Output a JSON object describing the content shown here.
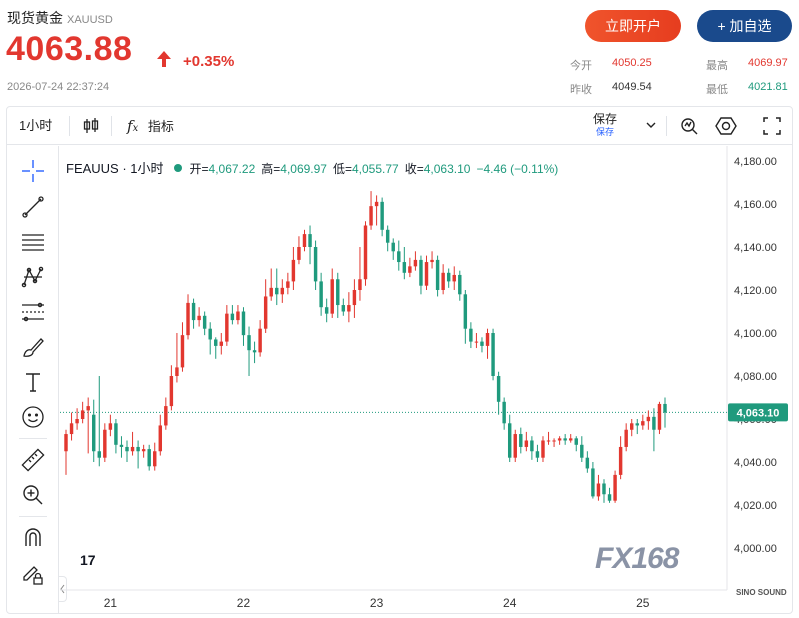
{
  "header": {
    "title": "现货黄金",
    "symbol": "XAUUSD",
    "price": "4063.88",
    "change": "+0.35%",
    "timestamp": "2026-07-24 22:37:24",
    "btn_open": "立即开户",
    "btn_add": "+ 加自选",
    "open_label": "今开",
    "open_value": "4050.25",
    "prev_label": "昨收",
    "prev_value": "4049.54",
    "high_label": "最高",
    "high_value": "4069.97",
    "low_label": "最低",
    "low_value": "4021.81"
  },
  "toolbar": {
    "interval": "1小时",
    "indicators": "指标",
    "save": "保存",
    "save_sub": "保存"
  },
  "sidebar": {
    "tools": [
      "crosshair-icon",
      "trend-line-icon",
      "horizontal-lines-icon",
      "pattern-icon",
      "fib-icon",
      "brush-icon",
      "text-icon",
      "emoji-icon",
      "ruler-icon",
      "zoom-in-icon",
      "magnet-icon",
      "lock-pencil-icon"
    ]
  },
  "legend": {
    "symbol": "FEAUUS · 1小时",
    "open_k": "开=",
    "open_v": "4,067.22",
    "high_k": "高=",
    "high_v": "4,069.97",
    "low_k": "低=",
    "low_v": "4,055.77",
    "close_k": "收=",
    "close_v": "4,063.10",
    "change_v": "−4.46 (−0.11%)"
  },
  "branding": {
    "tv": "17",
    "fx": "FX168",
    "sino": "SINO SOUND"
  },
  "colors": {
    "up": "#e2372f",
    "down": "#1f9a7d",
    "accent": "#2962ff",
    "brand_blue": "#1a4a8c"
  },
  "chart_data": {
    "type": "candlestick",
    "ylim": [
      3985,
      4185
    ],
    "y_ticks": [
      "4,000.00",
      "4,020.00",
      "4,040.00",
      "4,060.00",
      "4,080.00",
      "4,100.00",
      "4,120.00",
      "4,140.00",
      "4,160.00",
      "4,180.00"
    ],
    "y_tick_values": [
      4000,
      4020,
      4040,
      4060,
      4080,
      4100,
      4120,
      4140,
      4160,
      4180
    ],
    "x_labels": [
      "21",
      "22",
      "23",
      "24",
      "25"
    ],
    "x_label_index": [
      8,
      32,
      56,
      80,
      104
    ],
    "last_price_label": "4,063.10",
    "last_price": 4063.1,
    "candles": [
      [
        4045,
        4053,
        4034,
        4055
      ],
      [
        4053,
        4058,
        4050,
        4063
      ],
      [
        4058,
        4060,
        4055,
        4065
      ],
      [
        4060,
        4064,
        4058,
        4068
      ],
      [
        4064,
        4066,
        4044,
        4070
      ],
      [
        4062,
        4045,
        4040,
        4069
      ],
      [
        4045,
        4042,
        4038,
        4080
      ],
      [
        4042,
        4055,
        4040,
        4058
      ],
      [
        4055,
        4058,
        4052,
        4062
      ],
      [
        4058,
        4048,
        4044,
        4060
      ],
      [
        4048,
        4047,
        4042,
        4052
      ],
      [
        4047,
        4045,
        4040,
        4050
      ],
      [
        4045,
        4047,
        4043,
        4054
      ],
      [
        4047,
        4045,
        4037,
        4050
      ],
      [
        4045,
        4046,
        4042,
        4048
      ],
      [
        4046,
        4038,
        4036,
        4048
      ],
      [
        4038,
        4045,
        4036,
        4049
      ],
      [
        4045,
        4057,
        4043,
        4062
      ],
      [
        4057,
        4066,
        4055,
        4070
      ],
      [
        4066,
        4080,
        4064,
        4085
      ],
      [
        4080,
        4084,
        4077,
        4100
      ],
      [
        4084,
        4099,
        4082,
        4105
      ],
      [
        4099,
        4114,
        4097,
        4118
      ],
      [
        4114,
        4106,
        4102,
        4116
      ],
      [
        4106,
        4108,
        4103,
        4112
      ],
      [
        4108,
        4102,
        4099,
        4110
      ],
      [
        4102,
        4097,
        4090,
        4105
      ],
      [
        4097,
        4094,
        4088,
        4098
      ],
      [
        4094,
        4096,
        4090,
        4100
      ],
      [
        4096,
        4109,
        4094,
        4113
      ],
      [
        4109,
        4106,
        4104,
        4113
      ],
      [
        4106,
        4110,
        4104,
        4113
      ],
      [
        4110,
        4099,
        4094,
        4112
      ],
      [
        4099,
        4092,
        4080,
        4103
      ],
      [
        4092,
        4091,
        4086,
        4096
      ],
      [
        4091,
        4102,
        4089,
        4106
      ],
      [
        4102,
        4117,
        4100,
        4125
      ],
      [
        4117,
        4121,
        4115,
        4130
      ],
      [
        4121,
        4118,
        4113,
        4130
      ],
      [
        4118,
        4121,
        4114,
        4125
      ],
      [
        4121,
        4124,
        4118,
        4128
      ],
      [
        4124,
        4134,
        4120,
        4140
      ],
      [
        4134,
        4140,
        4132,
        4145
      ],
      [
        4140,
        4146,
        4138,
        4148
      ],
      [
        4146,
        4140,
        4132,
        4150
      ],
      [
        4140,
        4124,
        4120,
        4143
      ],
      [
        4124,
        4112,
        4108,
        4128
      ],
      [
        4112,
        4109,
        4105,
        4116
      ],
      [
        4109,
        4125,
        4107,
        4130
      ],
      [
        4125,
        4113,
        4107,
        4128
      ],
      [
        4113,
        4110,
        4108,
        4116
      ],
      [
        4110,
        4113,
        4105,
        4119
      ],
      [
        4113,
        4120,
        4107,
        4125
      ],
      [
        4120,
        4125,
        4115,
        4140
      ],
      [
        4125,
        4150,
        4122,
        4152
      ],
      [
        4150,
        4159,
        4148,
        4166
      ],
      [
        4159,
        4161,
        4150,
        4164
      ],
      [
        4161,
        4148,
        4145,
        4163
      ],
      [
        4148,
        4142,
        4138,
        4150
      ],
      [
        4142,
        4138,
        4134,
        4144
      ],
      [
        4138,
        4133,
        4129,
        4143
      ],
      [
        4133,
        4128,
        4125,
        4140
      ],
      [
        4128,
        4131,
        4126,
        4135
      ],
      [
        4131,
        4134,
        4129,
        4138
      ],
      [
        4134,
        4122,
        4118,
        4136
      ],
      [
        4122,
        4133,
        4120,
        4136
      ],
      [
        4133,
        4134,
        4130,
        4138
      ],
      [
        4134,
        4120,
        4117,
        4136
      ],
      [
        4120,
        4128,
        4118,
        4132
      ],
      [
        4128,
        4124,
        4121,
        4130
      ],
      [
        4124,
        4127,
        4120,
        4131
      ],
      [
        4127,
        4118,
        4115,
        4129
      ],
      [
        4118,
        4102,
        4095,
        4120
      ],
      [
        4102,
        4096,
        4093,
        4105
      ],
      [
        4096,
        4096,
        4093,
        4100
      ],
      [
        4096,
        4094,
        4091,
        4098
      ],
      [
        4094,
        4100,
        4088,
        4102
      ],
      [
        4100,
        4080,
        4078,
        4102
      ],
      [
        4080,
        4068,
        4062,
        4082
      ],
      [
        4068,
        4058,
        4055,
        4070
      ],
      [
        4058,
        4042,
        4040,
        4062
      ],
      [
        4042,
        4053,
        4040,
        4055
      ],
      [
        4053,
        4047,
        4044,
        4056
      ],
      [
        4047,
        4050,
        4045,
        4054
      ],
      [
        4050,
        4045,
        4041,
        4052
      ],
      [
        4045,
        4042,
        4040,
        4048
      ],
      [
        4042,
        4050,
        4040,
        4052
      ],
      [
        4050,
        4050,
        4048,
        4054
      ],
      [
        4050,
        4050,
        4047,
        4051
      ],
      [
        4050,
        4051,
        4048,
        4052
      ],
      [
        4051,
        4050,
        4048,
        4053
      ],
      [
        4050,
        4051,
        4049,
        4053
      ],
      [
        4051,
        4048,
        4045,
        4052
      ],
      [
        4048,
        4042,
        4040,
        4052
      ],
      [
        4042,
        4037,
        4035,
        4045
      ],
      [
        4037,
        4024,
        4023,
        4040
      ],
      [
        4024,
        4030,
        4022,
        4034
      ],
      [
        4030,
        4025,
        4021,
        4032
      ],
      [
        4025,
        4022,
        4021,
        4028
      ],
      [
        4022,
        4034,
        4021,
        4036
      ],
      [
        4034,
        4047,
        4032,
        4052
      ],
      [
        4047,
        4055,
        4045,
        4058
      ],
      [
        4055,
        4058,
        4052,
        4060
      ],
      [
        4058,
        4057,
        4053,
        4060
      ],
      [
        4057,
        4059,
        4055,
        4062
      ],
      [
        4059,
        4061,
        4055,
        4064
      ],
      [
        4061,
        4055,
        4045,
        4065
      ],
      [
        4055,
        4067,
        4053,
        4068
      ],
      [
        4067,
        4063,
        4056,
        4070
      ]
    ]
  }
}
